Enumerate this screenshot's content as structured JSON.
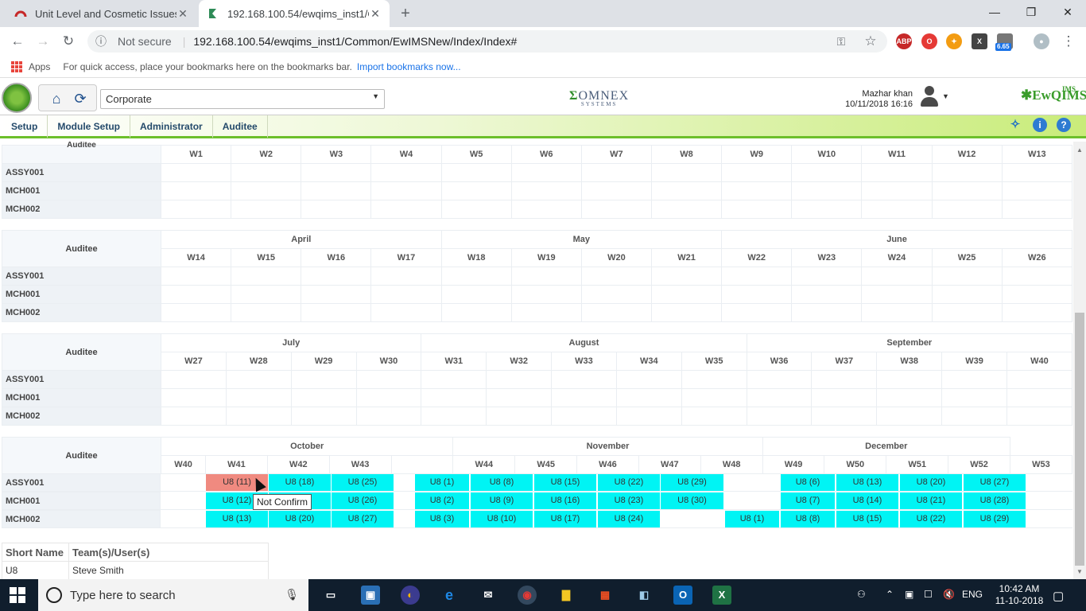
{
  "browser": {
    "tabs": [
      {
        "title": "Unit Level and Cosmetic Issues #",
        "close": "✕"
      },
      {
        "title": "192.168.100.54/ewqims_inst1/Co",
        "close": "✕"
      }
    ],
    "new_tab": "+",
    "security": "Not secure",
    "url": "192.168.100.54/ewqims_inst1/Common/EwIMSNew/Index/Index#",
    "bookmarks": {
      "apps": "Apps",
      "hint": "For quick access, place your bookmarks here on the bookmarks bar.",
      "import": "Import bookmarks now..."
    },
    "ext_badge": "6.65"
  },
  "app": {
    "company": "Corporate",
    "brand": "OMNEX",
    "brand_sub": "SYSTEMS",
    "user_name": "Mazhar khan",
    "user_datetime": "10/11/2018 16:16",
    "product": "EwQIMS",
    "product_sup": "IMS",
    "menu": [
      "Setup",
      "Module Setup",
      "Administrator",
      "Auditee"
    ]
  },
  "calendar": {
    "auditee_label": "Auditee",
    "rows": [
      "ASSY001",
      "MCH001",
      "MCH002"
    ],
    "q1_weeks": [
      "W1",
      "W2",
      "W3",
      "W4",
      "W5",
      "W6",
      "W7",
      "W8",
      "W9",
      "W10",
      "W11",
      "W12",
      "W13"
    ],
    "q2_months": [
      "April",
      "May",
      "June"
    ],
    "q2_weeks": [
      "W14",
      "W15",
      "W16",
      "W17",
      "W18",
      "W19",
      "W20",
      "W21",
      "W22",
      "W23",
      "W24",
      "W25",
      "W26"
    ],
    "q3_months": [
      "July",
      "August",
      "September"
    ],
    "q3_weeks": [
      "W27",
      "W28",
      "W29",
      "W30",
      "W31",
      "W32",
      "W33",
      "W34",
      "W35",
      "W36",
      "W37",
      "W38",
      "W39",
      "W40"
    ],
    "q4_months": [
      "October",
      "November",
      "December"
    ],
    "q4_weeks": [
      "W40",
      "W41",
      "W42",
      "W43",
      "W44",
      "W45",
      "W46",
      "W47",
      "W48",
      "W49",
      "W50",
      "W51",
      "W52",
      "W53"
    ],
    "q4_cells": {
      "assy": [
        "U8 (11)",
        "U8 (18)",
        "U8 (25)",
        "U8 (1)",
        "U8 (8)",
        "U8 (15)",
        "U8 (22)",
        "U8 (29)",
        "U8 (6)",
        "U8 (13)",
        "U8 (20)",
        "U8 (27)"
      ],
      "mch001": [
        "U8 (12)",
        "",
        "U8 (26)",
        "U8 (2)",
        "U8 (9)",
        "U8 (16)",
        "U8 (23)",
        "U8 (30)",
        "U8 (7)",
        "U8 (14)",
        "U8 (21)",
        "U8 (28)"
      ],
      "mch002": [
        "U8 (13)",
        "U8 (20)",
        "U8 (27)",
        "U8 (3)",
        "U8 (10)",
        "U8 (17)",
        "U8 (24)",
        "U8 (1)",
        "U8 (8)",
        "U8 (15)",
        "U8 (22)",
        "U8 (29)"
      ]
    },
    "tooltip": "Not Confirm",
    "colors": {
      "scheduled": "#00f4f4",
      "not_confirmed": "#f08a80"
    }
  },
  "legend": {
    "headers": [
      "Short Name",
      "Team(s)/User(s)"
    ],
    "row": [
      "U8",
      "Steve Smith"
    ]
  },
  "taskbar": {
    "search": "Type here to search",
    "lang": "ENG",
    "time": "10:42 AM",
    "date": "11-10-2018"
  }
}
